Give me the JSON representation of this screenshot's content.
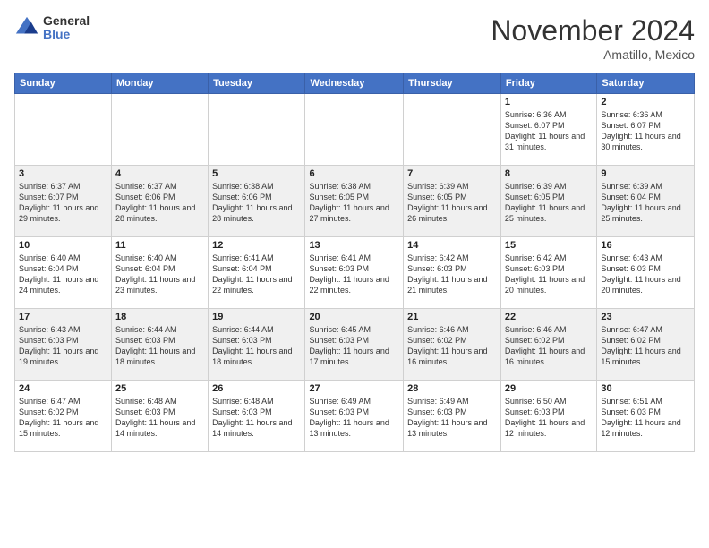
{
  "logo": {
    "general": "General",
    "blue": "Blue"
  },
  "title": "November 2024",
  "location": "Amatillo, Mexico",
  "days_of_week": [
    "Sunday",
    "Monday",
    "Tuesday",
    "Wednesday",
    "Thursday",
    "Friday",
    "Saturday"
  ],
  "weeks": [
    [
      {
        "day": "",
        "info": ""
      },
      {
        "day": "",
        "info": ""
      },
      {
        "day": "",
        "info": ""
      },
      {
        "day": "",
        "info": ""
      },
      {
        "day": "",
        "info": ""
      },
      {
        "day": "1",
        "info": "Sunrise: 6:36 AM\nSunset: 6:07 PM\nDaylight: 11 hours and 31 minutes."
      },
      {
        "day": "2",
        "info": "Sunrise: 6:36 AM\nSunset: 6:07 PM\nDaylight: 11 hours and 30 minutes."
      }
    ],
    [
      {
        "day": "3",
        "info": "Sunrise: 6:37 AM\nSunset: 6:07 PM\nDaylight: 11 hours and 29 minutes."
      },
      {
        "day": "4",
        "info": "Sunrise: 6:37 AM\nSunset: 6:06 PM\nDaylight: 11 hours and 28 minutes."
      },
      {
        "day": "5",
        "info": "Sunrise: 6:38 AM\nSunset: 6:06 PM\nDaylight: 11 hours and 28 minutes."
      },
      {
        "day": "6",
        "info": "Sunrise: 6:38 AM\nSunset: 6:05 PM\nDaylight: 11 hours and 27 minutes."
      },
      {
        "day": "7",
        "info": "Sunrise: 6:39 AM\nSunset: 6:05 PM\nDaylight: 11 hours and 26 minutes."
      },
      {
        "day": "8",
        "info": "Sunrise: 6:39 AM\nSunset: 6:05 PM\nDaylight: 11 hours and 25 minutes."
      },
      {
        "day": "9",
        "info": "Sunrise: 6:39 AM\nSunset: 6:04 PM\nDaylight: 11 hours and 25 minutes."
      }
    ],
    [
      {
        "day": "10",
        "info": "Sunrise: 6:40 AM\nSunset: 6:04 PM\nDaylight: 11 hours and 24 minutes."
      },
      {
        "day": "11",
        "info": "Sunrise: 6:40 AM\nSunset: 6:04 PM\nDaylight: 11 hours and 23 minutes."
      },
      {
        "day": "12",
        "info": "Sunrise: 6:41 AM\nSunset: 6:04 PM\nDaylight: 11 hours and 22 minutes."
      },
      {
        "day": "13",
        "info": "Sunrise: 6:41 AM\nSunset: 6:03 PM\nDaylight: 11 hours and 22 minutes."
      },
      {
        "day": "14",
        "info": "Sunrise: 6:42 AM\nSunset: 6:03 PM\nDaylight: 11 hours and 21 minutes."
      },
      {
        "day": "15",
        "info": "Sunrise: 6:42 AM\nSunset: 6:03 PM\nDaylight: 11 hours and 20 minutes."
      },
      {
        "day": "16",
        "info": "Sunrise: 6:43 AM\nSunset: 6:03 PM\nDaylight: 11 hours and 20 minutes."
      }
    ],
    [
      {
        "day": "17",
        "info": "Sunrise: 6:43 AM\nSunset: 6:03 PM\nDaylight: 11 hours and 19 minutes."
      },
      {
        "day": "18",
        "info": "Sunrise: 6:44 AM\nSunset: 6:03 PM\nDaylight: 11 hours and 18 minutes."
      },
      {
        "day": "19",
        "info": "Sunrise: 6:44 AM\nSunset: 6:03 PM\nDaylight: 11 hours and 18 minutes."
      },
      {
        "day": "20",
        "info": "Sunrise: 6:45 AM\nSunset: 6:03 PM\nDaylight: 11 hours and 17 minutes."
      },
      {
        "day": "21",
        "info": "Sunrise: 6:46 AM\nSunset: 6:02 PM\nDaylight: 11 hours and 16 minutes."
      },
      {
        "day": "22",
        "info": "Sunrise: 6:46 AM\nSunset: 6:02 PM\nDaylight: 11 hours and 16 minutes."
      },
      {
        "day": "23",
        "info": "Sunrise: 6:47 AM\nSunset: 6:02 PM\nDaylight: 11 hours and 15 minutes."
      }
    ],
    [
      {
        "day": "24",
        "info": "Sunrise: 6:47 AM\nSunset: 6:02 PM\nDaylight: 11 hours and 15 minutes."
      },
      {
        "day": "25",
        "info": "Sunrise: 6:48 AM\nSunset: 6:03 PM\nDaylight: 11 hours and 14 minutes."
      },
      {
        "day": "26",
        "info": "Sunrise: 6:48 AM\nSunset: 6:03 PM\nDaylight: 11 hours and 14 minutes."
      },
      {
        "day": "27",
        "info": "Sunrise: 6:49 AM\nSunset: 6:03 PM\nDaylight: 11 hours and 13 minutes."
      },
      {
        "day": "28",
        "info": "Sunrise: 6:49 AM\nSunset: 6:03 PM\nDaylight: 11 hours and 13 minutes."
      },
      {
        "day": "29",
        "info": "Sunrise: 6:50 AM\nSunset: 6:03 PM\nDaylight: 11 hours and 12 minutes."
      },
      {
        "day": "30",
        "info": "Sunrise: 6:51 AM\nSunset: 6:03 PM\nDaylight: 11 hours and 12 minutes."
      }
    ]
  ]
}
